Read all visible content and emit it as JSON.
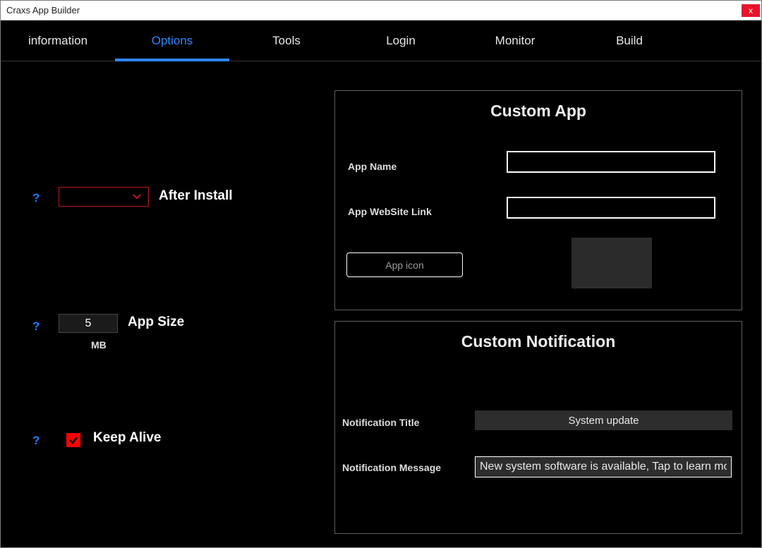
{
  "window": {
    "title": "Craxs App Builder",
    "close_glyph": "x"
  },
  "nav": {
    "items": [
      {
        "label": "information"
      },
      {
        "label": "Options"
      },
      {
        "label": "Tools"
      },
      {
        "label": "Login"
      },
      {
        "label": "Monitor"
      },
      {
        "label": "Build"
      }
    ],
    "active_index": 1
  },
  "left": {
    "help_glyph": "?",
    "after_install_label": "After Install",
    "after_install_value": "",
    "app_size_value": "5",
    "app_size_label": "App Size",
    "app_size_unit": "MB",
    "keep_alive_checked": true,
    "keep_alive_label": "Keep Alive"
  },
  "custom_app": {
    "title": "Custom App",
    "app_name_label": "App Name",
    "app_name_value": "",
    "app_link_label": "App WebSite Link",
    "app_link_value": "",
    "app_icon_btn": "App icon"
  },
  "custom_notif": {
    "title": "Custom Notification",
    "notif_title_label": "Notification Title",
    "notif_title_value": "System update",
    "notif_msg_label": "Notification Message",
    "notif_msg_value": "New system software is available, Tap to learn mo"
  }
}
